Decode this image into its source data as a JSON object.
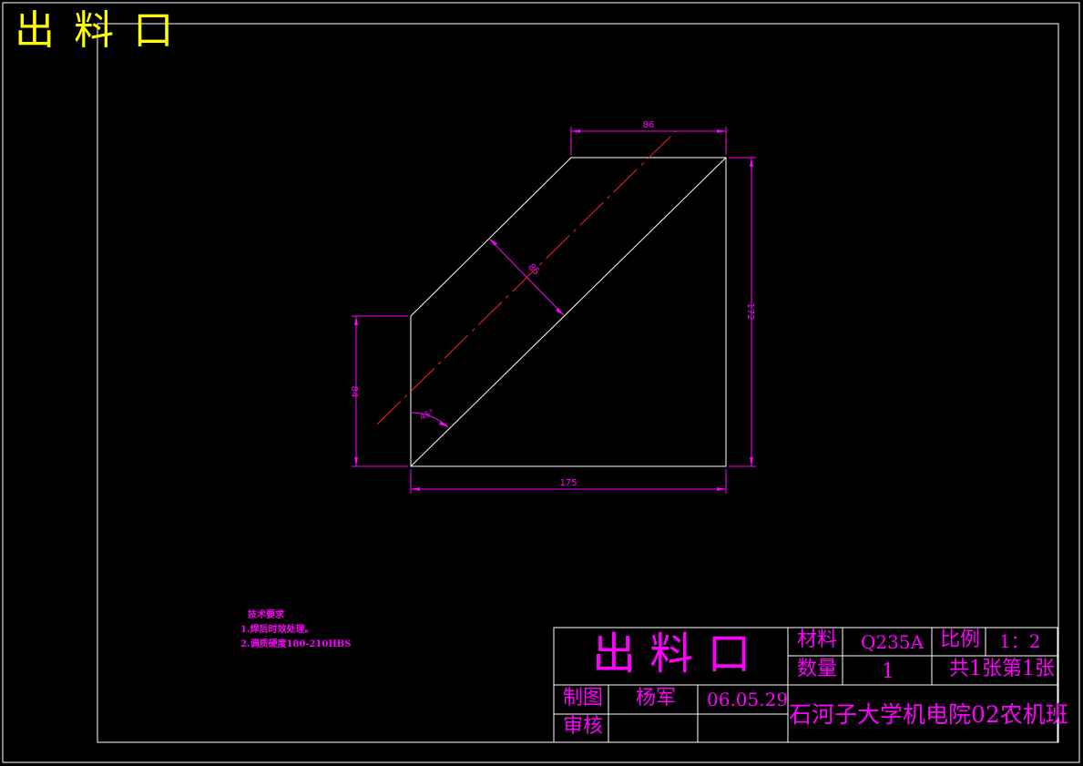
{
  "sheet_title": "出料口",
  "drawing": {
    "dimensions": {
      "top_width": "86",
      "bottom_width": "175",
      "right_height": "172",
      "left_height": "84",
      "thickness": "85",
      "angle": "45°"
    }
  },
  "tech_requirements": {
    "title": "技术要求",
    "items": [
      "1.焊后时效处理。",
      "2.调质硬度180-210HBS"
    ]
  },
  "title_block": {
    "part_name": "出 料 口",
    "material_label": "材料",
    "material_value": "Q235A",
    "scale_label": "比例",
    "scale_value": "1：2",
    "quantity_label": "数量",
    "quantity_value": "1",
    "sheets": "共1张第1张",
    "drawn_label": "制图",
    "drawn_by": "杨军",
    "date": "06.05.29",
    "review_label": "审核",
    "review_by": "",
    "organization": "石河子大学机电院02农机班"
  },
  "colors": {
    "background": "#000000",
    "outline": "#ffffff",
    "dimension": "#ff00ff",
    "centerline": "#ff0000",
    "title_text": "#ffff00"
  }
}
